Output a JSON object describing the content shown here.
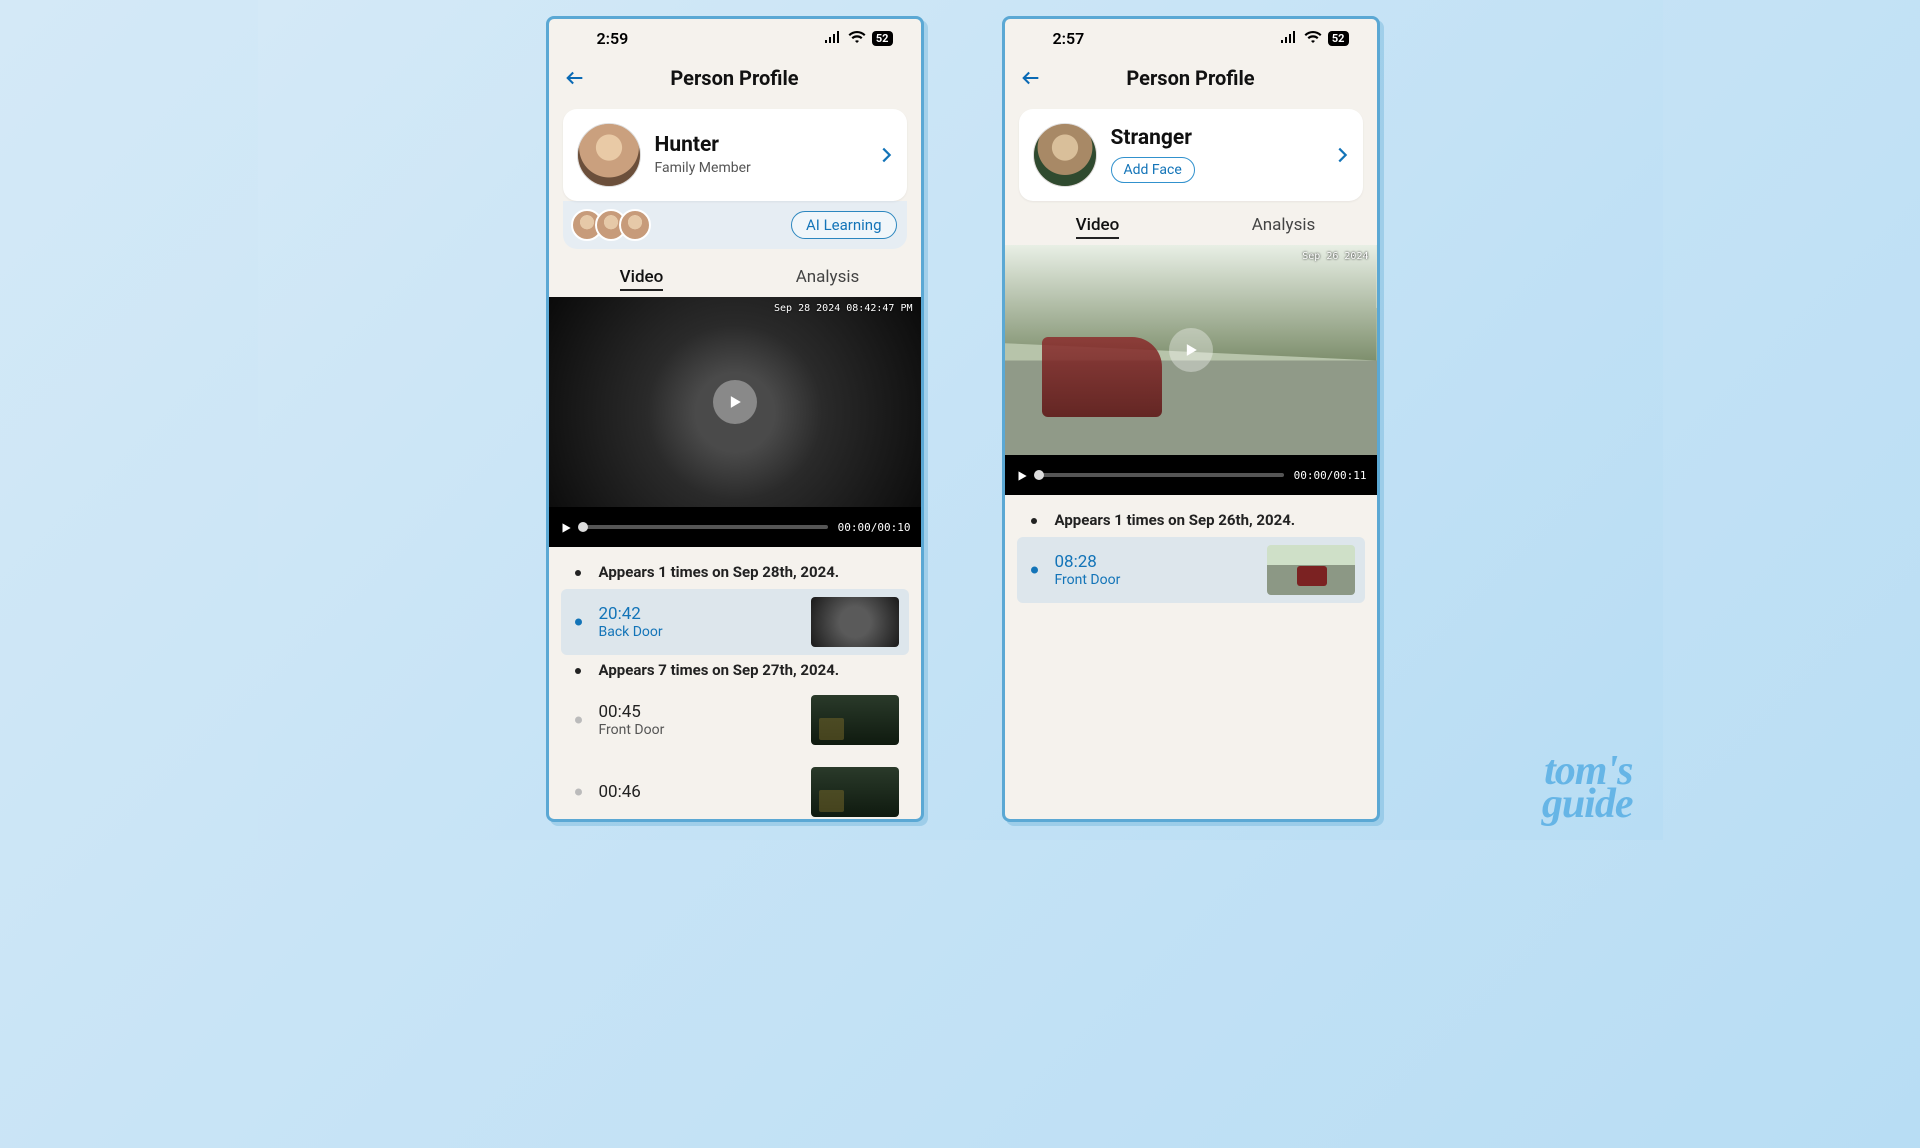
{
  "watermark": {
    "line1": "tom's",
    "line2": "guide"
  },
  "screens": [
    {
      "status": {
        "time": "2:59",
        "battery": "52"
      },
      "nav": {
        "title": "Person Profile"
      },
      "profile": {
        "name": "Hunter",
        "subtitle": "Family Member",
        "show_add_face": false,
        "ai_learning_label": "AI Learning",
        "mini_avatars": 3
      },
      "tabs": {
        "video": "Video",
        "analysis": "Analysis",
        "active": "video"
      },
      "video": {
        "stamp": "Sep 28 2024   08:42:47 PM",
        "time_cur": "00:00",
        "time_dur": "00:10",
        "scene": "night"
      },
      "timeline": [
        {
          "title": "Appears 1 times on Sep 28th, 2024.",
          "items": [
            {
              "time": "20:42",
              "location": "Back Door",
              "selected": true,
              "thumb": "night"
            }
          ]
        },
        {
          "title": "Appears 7 times on Sep 27th, 2024.",
          "items": [
            {
              "time": "00:45",
              "location": "Front Door",
              "selected": false,
              "thumb": "dusk"
            },
            {
              "time": "00:46",
              "location": "",
              "selected": false,
              "thumb": "dusk"
            }
          ]
        }
      ]
    },
    {
      "status": {
        "time": "2:57",
        "battery": "52"
      },
      "nav": {
        "title": "Person Profile"
      },
      "profile": {
        "name": "Stranger",
        "subtitle": "",
        "show_add_face": true,
        "add_face_label": "Add Face"
      },
      "tabs": {
        "video": "Video",
        "analysis": "Analysis",
        "active": "video"
      },
      "video": {
        "stamp": "Sep 26 2024",
        "time_cur": "00:00",
        "time_dur": "00:11",
        "scene": "day"
      },
      "timeline": [
        {
          "title": "Appears 1 times on Sep 26th, 2024.",
          "items": [
            {
              "time": "08:28",
              "location": "Front Door",
              "selected": true,
              "thumb": "day"
            }
          ]
        }
      ]
    }
  ]
}
